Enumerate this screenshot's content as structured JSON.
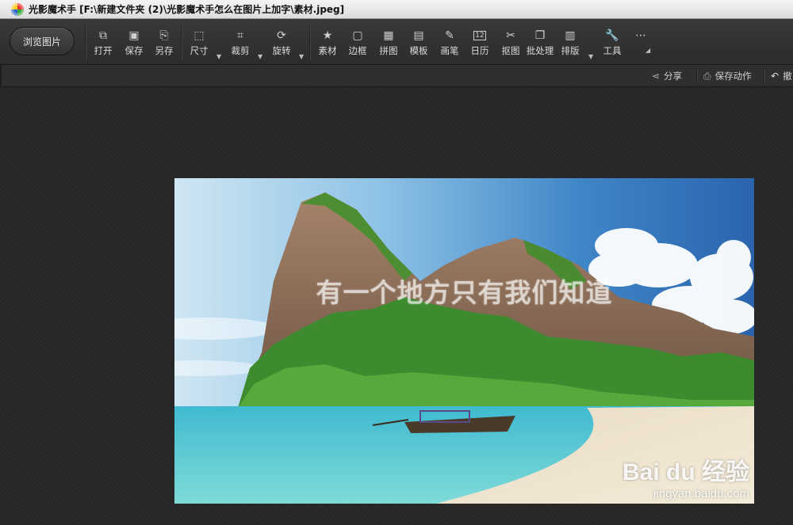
{
  "window": {
    "title": "光影魔术手 [F:\\新建文件夹 (2)\\光影魔术手怎么在图片上加字\\素材.jpeg]"
  },
  "toolbar": {
    "browse_label": "浏览图片",
    "items": [
      {
        "label": "打开",
        "icon": "open-icon"
      },
      {
        "label": "保存",
        "icon": "save-icon"
      },
      {
        "label": "另存",
        "icon": "save-as-icon"
      },
      {
        "label": "尺寸",
        "icon": "resize-icon"
      },
      {
        "label": "裁剪",
        "icon": "crop-icon"
      },
      {
        "label": "旋转",
        "icon": "rotate-icon"
      },
      {
        "label": "素材",
        "icon": "material-icon"
      },
      {
        "label": "边框",
        "icon": "border-icon"
      },
      {
        "label": "拼图",
        "icon": "collage-icon"
      },
      {
        "label": "模板",
        "icon": "template-icon"
      },
      {
        "label": "画笔",
        "icon": "brush-icon"
      },
      {
        "label": "日历",
        "icon": "calendar-icon"
      },
      {
        "label": "抠图",
        "icon": "cutout-icon"
      },
      {
        "label": "批处理",
        "icon": "batch-icon"
      },
      {
        "label": "排版",
        "icon": "layout-icon"
      },
      {
        "label": "工具",
        "icon": "tools-icon"
      },
      {
        "label": "",
        "icon": "more-icon"
      }
    ],
    "calendar_day": "12"
  },
  "subbar": {
    "share_label": "分享",
    "save_action_label": "保存动作",
    "back_label": "撤"
  },
  "photo": {
    "overlay_text": "有一个地方只有我们知道",
    "watermark_brand": "Bai du 经验",
    "watermark_url": "jingyan.baidu.com"
  }
}
